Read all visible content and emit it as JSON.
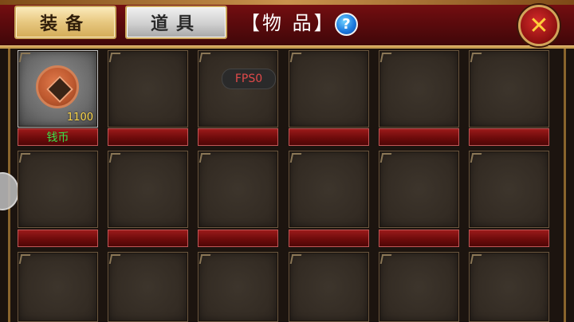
{
  "tabs": [
    {
      "label": "装备",
      "active": true
    },
    {
      "label": "道具",
      "active": false
    }
  ],
  "title": "【物 品】",
  "help_label": "?",
  "close_label": "✕",
  "overlay": {
    "fps": "FPS0"
  },
  "inventory": {
    "items": [
      {
        "name": "钱币",
        "quantity": "1100",
        "icon": "coin-icon"
      }
    ]
  },
  "colors": {
    "header": "#6b0d10",
    "gold_accent": "#c59a4e",
    "item_name": "#38e24a",
    "quantity": "#ffd84a",
    "fps_text": "#e04949"
  }
}
